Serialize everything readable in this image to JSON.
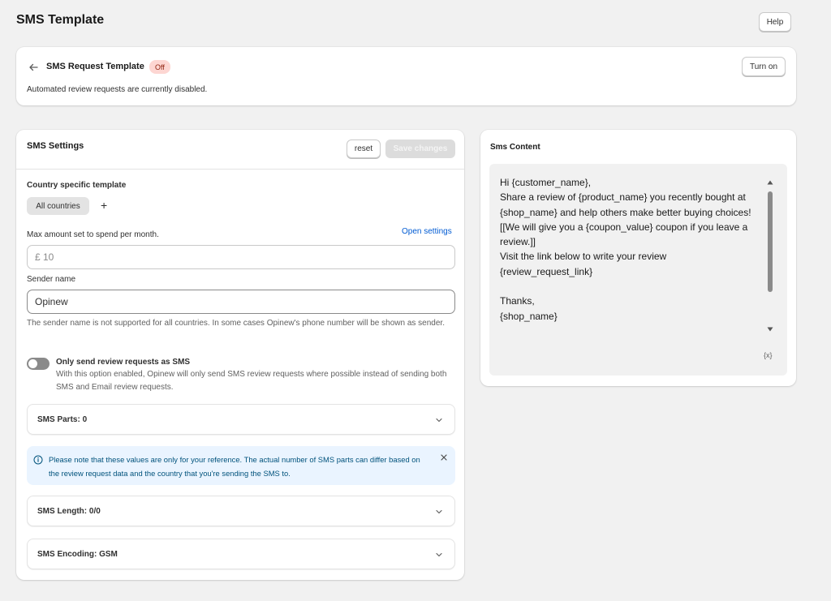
{
  "page": {
    "title": "SMS Template",
    "help_label": "Help"
  },
  "request_card": {
    "title": "SMS Request Template",
    "status_badge": "Off",
    "turn_on_label": "Turn on",
    "description": "Automated review requests are currently disabled."
  },
  "settings": {
    "title": "SMS Settings",
    "reset_label": "reset",
    "save_label": "Save changes",
    "country_label": "Country specific template",
    "country_chip": "All countries",
    "add_label": "+",
    "max_amount_label": "Max amount set to spend per month.",
    "open_settings_link": "Open settings",
    "max_amount_value": "£ 10",
    "sender_label": "Sender name",
    "sender_value": "Opinew",
    "sender_help": "The sender name is not supported for all countries. In some cases Opinew's phone number will be shown as sender.",
    "toggle_title": "Only send review requests as SMS",
    "toggle_desc": "With this option enabled, Opinew will only send SMS review requests where possible instead of sending both SMS and Email review requests.",
    "toggle_on": false,
    "sms_parts": "SMS Parts: 0",
    "info_banner": "Please note that these values are only for your reference. The actual number of SMS parts can differ based on the review request data and the country that you're sending the SMS to.",
    "sms_length": "SMS Length: 0/0",
    "sms_encoding": "SMS Encoding: GSM"
  },
  "content": {
    "title": "Sms Content",
    "body": "Hi {customer_name},\nShare a review of {product_name} you recently bought at {shop_name} and help others make better buying choices!\n[[We will give you a {coupon_value} coupon if you leave a review.]]\nVisit the link below to write your review\n{review_request_link}\n\nThanks,\n{shop_name}",
    "variable_icon_label": "{x}"
  },
  "colors": {
    "background": "#f1f1f1",
    "link": "#005bd3",
    "badge_bg": "#fdd6d2",
    "badge_text": "#8e1f0b",
    "info_bg": "#eaf4ff",
    "info_text": "#00527c"
  }
}
